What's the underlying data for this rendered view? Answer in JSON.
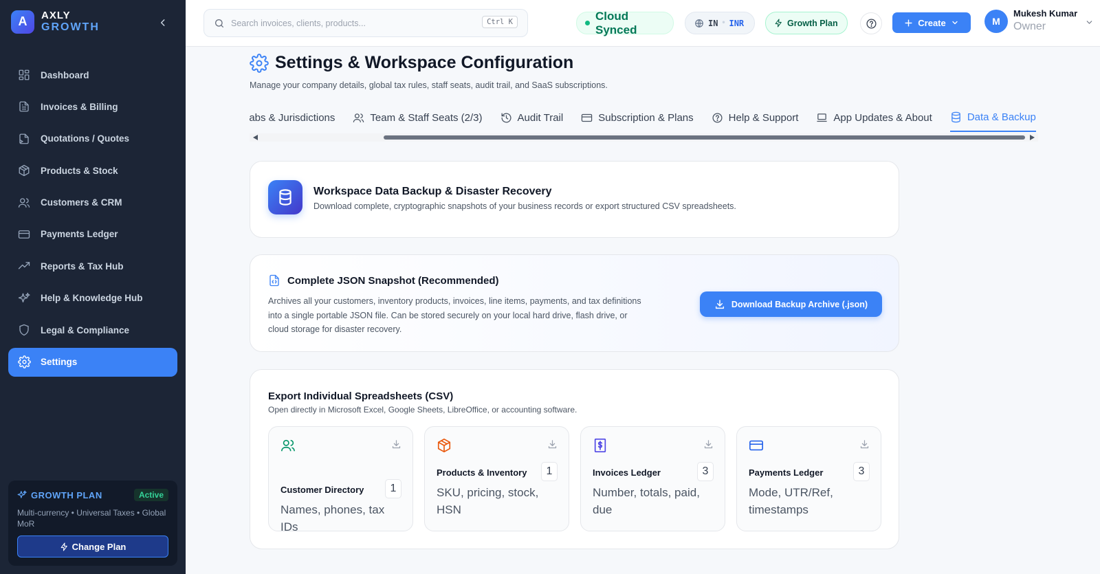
{
  "brand": {
    "logo_letter": "A",
    "name": "AXLY",
    "sub": "GROWTH"
  },
  "sidebar": {
    "items": [
      {
        "label": "Dashboard",
        "icon": "grid-icon"
      },
      {
        "label": "Invoices & Billing",
        "icon": "document-icon"
      },
      {
        "label": "Quotations / Quotes",
        "icon": "quote-document-icon"
      },
      {
        "label": "Products & Stock",
        "icon": "box-icon"
      },
      {
        "label": "Customers & CRM",
        "icon": "users-icon"
      },
      {
        "label": "Payments Ledger",
        "icon": "card-icon"
      },
      {
        "label": "Reports & Tax Hub",
        "icon": "trend-up-icon"
      },
      {
        "label": "Help & Knowledge Hub",
        "icon": "sparkles-icon"
      },
      {
        "label": "Legal & Compliance",
        "icon": "shield-icon"
      },
      {
        "label": "Settings",
        "icon": "gear-icon",
        "active": true
      }
    ]
  },
  "plan_card": {
    "title": "GROWTH PLAN",
    "badge": "Active",
    "desc": "Multi-currency • Universal Taxes • Global MoR",
    "button": "Change Plan"
  },
  "topbar": {
    "search_placeholder": "Search invoices, clients, products...",
    "shortcut": "Ctrl K",
    "sync_status": "Cloud Synced",
    "region_code": "IN",
    "currency": "INR",
    "plan_pill": "Growth Plan",
    "create_label": "Create",
    "user": {
      "initial": "M",
      "name": "Mukesh Kumar",
      "role": "Owner"
    }
  },
  "page": {
    "title": "Settings & Workspace Configuration",
    "desc": "Manage your company details, global tax rules, staff seats, audit trail, and SaaS subscriptions."
  },
  "tabs": [
    {
      "label": "labs & Jurisdictions",
      "icon": ""
    },
    {
      "label": "Team & Staff Seats (2/3)",
      "icon": "users-icon"
    },
    {
      "label": "Audit Trail",
      "icon": "history-icon"
    },
    {
      "label": "Subscription & Plans",
      "icon": "card-icon"
    },
    {
      "label": "Help & Support",
      "icon": "help-circle-icon"
    },
    {
      "label": "App Updates & About",
      "icon": "laptop-icon"
    },
    {
      "label": "Data & Backup",
      "icon": "database-icon",
      "active": true
    }
  ],
  "hero": {
    "title": "Workspace Data Backup & Disaster Recovery",
    "desc": "Download complete, cryptographic snapshots of your business records or export structured CSV spreadsheets."
  },
  "json_backup": {
    "title": "Complete JSON Snapshot (Recommended)",
    "desc": "Archives all your customers, inventory products, invoices, line items, payments, and tax definitions into a single portable JSON file. Can be stored securely on your local hard drive, flash drive, or cloud storage for disaster recovery.",
    "button": "Download Backup Archive (.json)"
  },
  "csv": {
    "title": "Export Individual Spreadsheets (CSV)",
    "desc": "Open directly in Microsoft Excel, Google Sheets, LibreOffice, or accounting software.",
    "tiles": [
      {
        "name": "Customer Directory",
        "count": "1",
        "desc": "Names, phones, tax IDs",
        "icon": "users-icon",
        "color": "#059669"
      },
      {
        "name": "Products & Inventory",
        "count": "1",
        "desc": "SKU, pricing, stock, HSN",
        "icon": "box-icon",
        "color": "#ea580c"
      },
      {
        "name": "Invoices Ledger",
        "count": "3",
        "desc": "Number, totals, paid, due",
        "icon": "dollar-document-icon",
        "color": "#4f46e5"
      },
      {
        "name": "Payments Ledger",
        "count": "3",
        "desc": "Mode, UTR/Ref, timestamps",
        "icon": "card-icon",
        "color": "#2563eb"
      }
    ]
  },
  "colors": {
    "accent": "#3b82f6",
    "sidebar_bg": "#1c2536",
    "success": "#10b981"
  }
}
